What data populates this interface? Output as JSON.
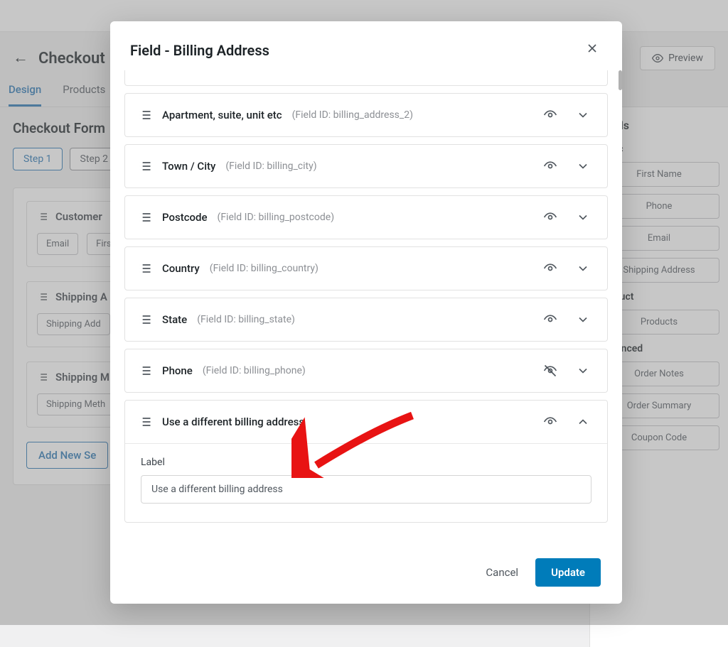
{
  "bg": {
    "title": "Checkout",
    "preview": "Preview",
    "tabs": [
      "Design",
      "Products"
    ],
    "subtitle": "Checkout Form",
    "steps": [
      "Step 1",
      "Step 2"
    ],
    "sections": {
      "customer": {
        "title": "Customer",
        "items": [
          "Email",
          "First"
        ]
      },
      "shippingA": {
        "title": "Shipping A",
        "items": [
          "Shipping Add"
        ]
      },
      "shippingM": {
        "title": "Shipping M",
        "items": [
          "Shipping Meth"
        ]
      }
    },
    "addNew": "Add New Se"
  },
  "sidebar": {
    "title": "Fields",
    "groups": {
      "basic": {
        "title": "Basic",
        "items": [
          "First Name",
          "Phone",
          "Email",
          "Shipping Address"
        ]
      },
      "product": {
        "title": "Product",
        "items": [
          "Products"
        ]
      },
      "advanced": {
        "title": "Advanced",
        "items": [
          "Order Notes",
          "Order Summary",
          "Coupon Code"
        ]
      }
    }
  },
  "modal": {
    "title": "Field - Billing Address",
    "fields": [
      {
        "label": "Apartment, suite, unit etc",
        "id": "(Field ID: billing_address_2)",
        "hidden": false
      },
      {
        "label": "Town / City",
        "id": "(Field ID: billing_city)",
        "hidden": false
      },
      {
        "label": "Postcode",
        "id": "(Field ID: billing_postcode)",
        "hidden": false
      },
      {
        "label": "Country",
        "id": "(Field ID: billing_country)",
        "hidden": false
      },
      {
        "label": "State",
        "id": "(Field ID: billing_state)",
        "hidden": false
      },
      {
        "label": "Phone",
        "id": "(Field ID: billing_phone)",
        "hidden": true
      },
      {
        "label": "Use a different billing address",
        "id": "",
        "hidden": false,
        "expanded": true
      }
    ],
    "expanded": {
      "labelTitle": "Label",
      "labelValue": "Use a different billing address"
    },
    "cancel": "Cancel",
    "update": "Update"
  }
}
